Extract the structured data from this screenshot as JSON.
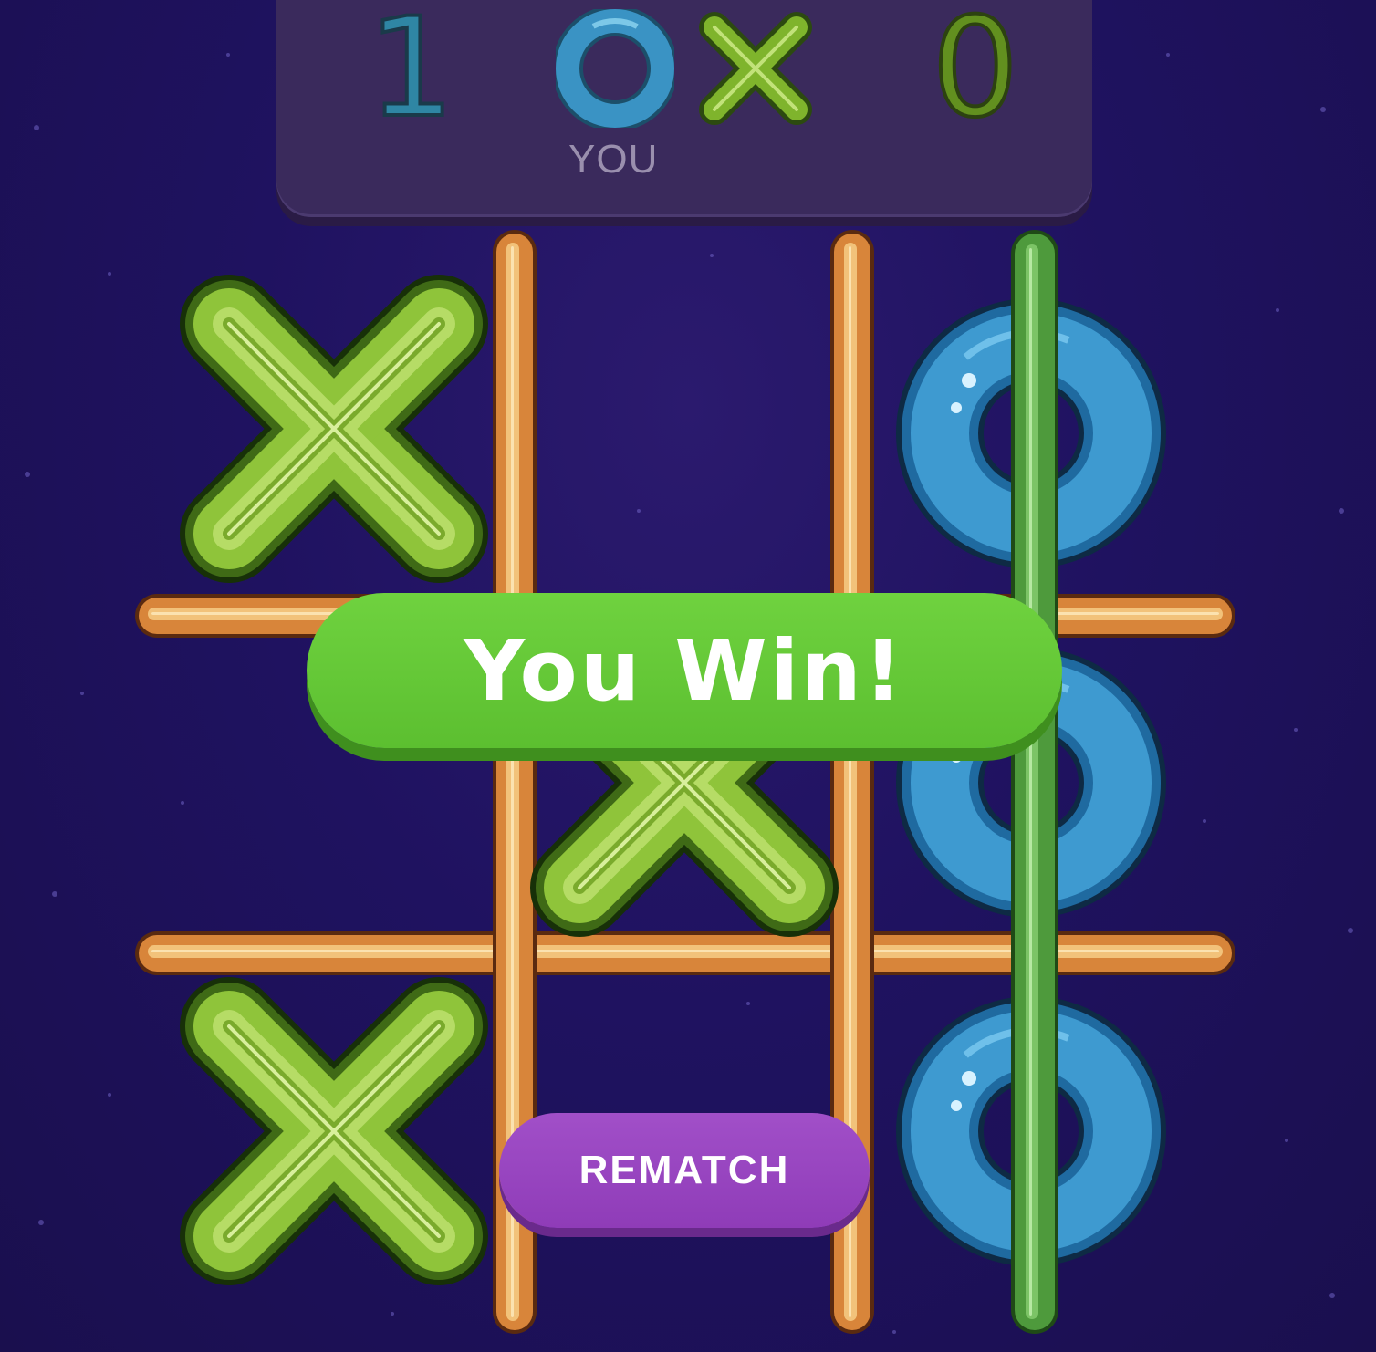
{
  "scoreboard": {
    "o_score": "1",
    "x_score": "0",
    "player_label": "YOU",
    "o_icon": "o-piece-icon",
    "x_icon": "x-piece-icon"
  },
  "board": {
    "cells": [
      "X",
      "",
      "O",
      "",
      "X",
      "O",
      "X",
      "",
      "O"
    ],
    "winning_line": "column-3",
    "grid_color": "#d88a3a",
    "win_line_color": "#4e9a3c",
    "x_color": "#8fc43a",
    "o_color": "#3a8fc0"
  },
  "result": {
    "message": "You Win!",
    "banner_color": "#66c83a"
  },
  "actions": {
    "rematch_label": "REMATCH",
    "rematch_color": "#9a45c2"
  }
}
